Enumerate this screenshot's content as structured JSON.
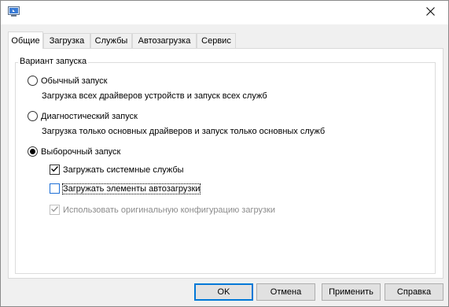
{
  "tabs": [
    {
      "label": "Общие"
    },
    {
      "label": "Загрузка"
    },
    {
      "label": "Службы"
    },
    {
      "label": "Автозагрузка"
    },
    {
      "label": "Сервис"
    }
  ],
  "group": {
    "title": "Вариант запуска",
    "options": [
      {
        "label": "Обычный запуск",
        "description": "Загрузка всех драйверов устройств и запуск всех служб",
        "checked": false
      },
      {
        "label": "Диагностический запуск",
        "description": "Загрузка только основных драйверов и запуск только основных служб",
        "checked": false
      },
      {
        "label": "Выборочный запуск",
        "checked": true
      }
    ],
    "checks": [
      {
        "label": "Загружать системные службы",
        "checked": true,
        "enabled": true
      },
      {
        "label": "Загружать элементы автозагрузки",
        "checked": false,
        "enabled": true
      },
      {
        "label": "Использовать оригинальную конфигурацию загрузки",
        "checked": true,
        "enabled": false
      }
    ]
  },
  "buttons": {
    "ok": "OK",
    "cancel": "Отмена",
    "apply": "Применить",
    "help": "Справка"
  },
  "colors": {
    "accent": "#0078d7",
    "focus_box": "#1e6fd6"
  }
}
